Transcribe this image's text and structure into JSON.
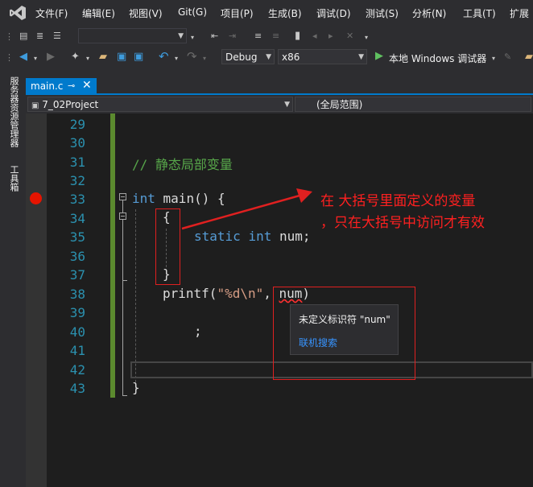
{
  "menubar": {
    "items": [
      "文件(F)",
      "编辑(E)",
      "视图(V)",
      "Git(G)",
      "项目(P)",
      "生成(B)",
      "调试(D)",
      "测试(S)",
      "分析(N)",
      "工具(T)",
      "扩展"
    ]
  },
  "toolbar": {
    "config": "Debug",
    "platform": "x86",
    "run_label": "本地 Windows 调试器"
  },
  "siderail": {
    "tabs": [
      "服务器资源管理器",
      "工具箱"
    ]
  },
  "tabs": [
    {
      "label": "main.c",
      "active": true
    }
  ],
  "navbar": {
    "project": "7_02Project",
    "scope": "(全局范围)"
  },
  "editor": {
    "line_numbers": [
      "29",
      "30",
      "31",
      "32",
      "33",
      "34",
      "35",
      "36",
      "37",
      "38",
      "39",
      "40",
      "41",
      "42",
      "43"
    ],
    "comment": "// 静态局部变量",
    "line33": {
      "kw": "int",
      "rest": " main() {"
    },
    "line34": "{",
    "line35": {
      "kw1": "static",
      "kw2": "int",
      "rest": " num;"
    },
    "line37": "}",
    "line38": {
      "fn": "printf(",
      "str": "\"%d\\n\"",
      "rest": ", ",
      "err": "num",
      "close": ")"
    },
    "line40": ";",
    "line43": "}"
  },
  "tooltip": {
    "message": "未定义标识符 \"num\"",
    "link": "联机搜索"
  },
  "annotation": {
    "line1": "在 大括号里面定义的变量",
    "line2": "，只在大括号中访问才有效"
  },
  "colors": {
    "accent": "#007acc",
    "annotation_red": "#ff2020",
    "breakpoint": "#e51400",
    "change_bar": "#5b8a2e"
  }
}
